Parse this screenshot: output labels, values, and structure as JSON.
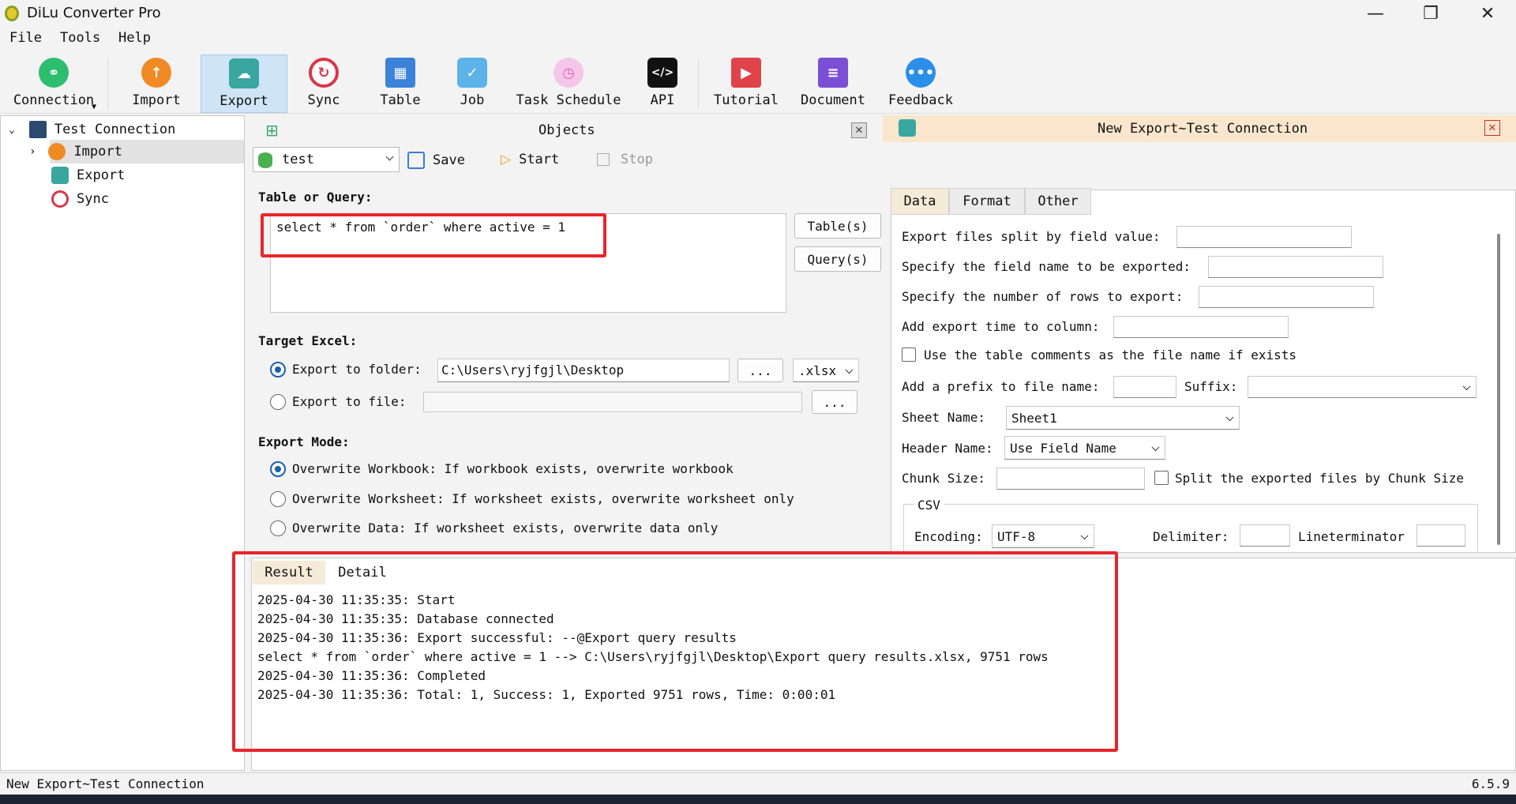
{
  "window": {
    "title": "DiLu Converter Pro",
    "minimize": "—",
    "maximize": "❐",
    "close": "✕"
  },
  "menu": [
    "File",
    "Tools",
    "Help"
  ],
  "toolbar": {
    "items": [
      {
        "label": "Connection",
        "icon": "link-icon",
        "color": "#2dbd6e"
      },
      {
        "label": "Import",
        "icon": "cloud-import-icon",
        "color": "#f08a24"
      },
      {
        "label": "Export",
        "icon": "cloud-export-icon",
        "color": "#3aa6a0"
      },
      {
        "label": "Sync",
        "icon": "sync-icon",
        "color": "#d9364a"
      },
      {
        "label": "Table",
        "icon": "table-icon",
        "color": "#3b82d9"
      },
      {
        "label": "Job",
        "icon": "job-icon",
        "color": "#5bb3e8"
      },
      {
        "label": "Task Schedule",
        "icon": "clock-icon",
        "color": "#e05cc0"
      },
      {
        "label": "API",
        "icon": "code-icon",
        "color": "#111111"
      },
      {
        "label": "Tutorial",
        "icon": "book-icon",
        "color": "#e0434a"
      },
      {
        "label": "Document",
        "icon": "document-icon",
        "color": "#7a4fd6"
      },
      {
        "label": "Feedback",
        "icon": "chat-icon",
        "color": "#2b8ee8"
      }
    ]
  },
  "tree": {
    "root": "Test Connection",
    "children": [
      "Import",
      "Export",
      "Sync"
    ]
  },
  "objects_panel": {
    "title": "Objects",
    "database": "test",
    "save": "Save",
    "start": "Start",
    "stop": "Stop"
  },
  "export_panel": {
    "title": "New Export~Test Connection"
  },
  "form": {
    "table_or_query_label": "Table or Query:",
    "query": "select * from `order` where active = 1",
    "tables_button": "Table(s)",
    "queries_button": "Query(s)",
    "target_excel_label": "Target Excel:",
    "export_to_folder": "Export to folder:",
    "folder_path": "C:\\Users\\ryjfgjl\\Desktop",
    "browse": "...",
    "extension": ".xlsx",
    "export_to_file": "Export to file:",
    "export_mode_label": "Export Mode:",
    "modes": [
      "Overwrite Workbook: If workbook exists, overwrite workbook",
      "Overwrite Worksheet: If worksheet exists, overwrite worksheet only",
      "Overwrite Data: If worksheet exists, overwrite data only"
    ]
  },
  "right": {
    "tabs": [
      "Data",
      "Format",
      "Other"
    ],
    "split_by_field": "Export files split by field value:",
    "field_names": "Specify the field name to be exported:",
    "num_rows": "Specify the number of rows to export:",
    "export_time": "Add export time to column:",
    "use_comments": "Use the table comments as the file name if exists",
    "prefix": "Add a prefix to file name:",
    "suffix": "Suffix:",
    "sheet_name_label": "Sheet Name:",
    "sheet_name": "Sheet1",
    "header_name_label": "Header Name:",
    "header_name": "Use Field Name",
    "chunk_size": "Chunk Size:",
    "split_chunk": "Split the exported files by Chunk Size",
    "csv_group": "CSV",
    "encoding_label": "Encoding:",
    "encoding": "UTF-8",
    "delimiter": "Delimiter:",
    "lineterminator": "Lineterminator"
  },
  "result": {
    "tabs": [
      "Result",
      "Detail"
    ],
    "lines": [
      "2025-04-30 11:35:35: Start",
      "2025-04-30 11:35:35: Database connected",
      "2025-04-30 11:35:36: Export successful: --@Export query results",
      "select * from `order` where active = 1 --> C:\\Users\\ryjfgjl\\Desktop\\Export query results.xlsx, 9751 rows",
      "2025-04-30 11:35:36: Completed",
      "2025-04-30 11:35:36: Total: 1, Success: 1, Exported 9751 rows, Time: 0:00:01"
    ]
  },
  "status": {
    "left": "New Export~Test Connection",
    "version": "6.5.9"
  }
}
